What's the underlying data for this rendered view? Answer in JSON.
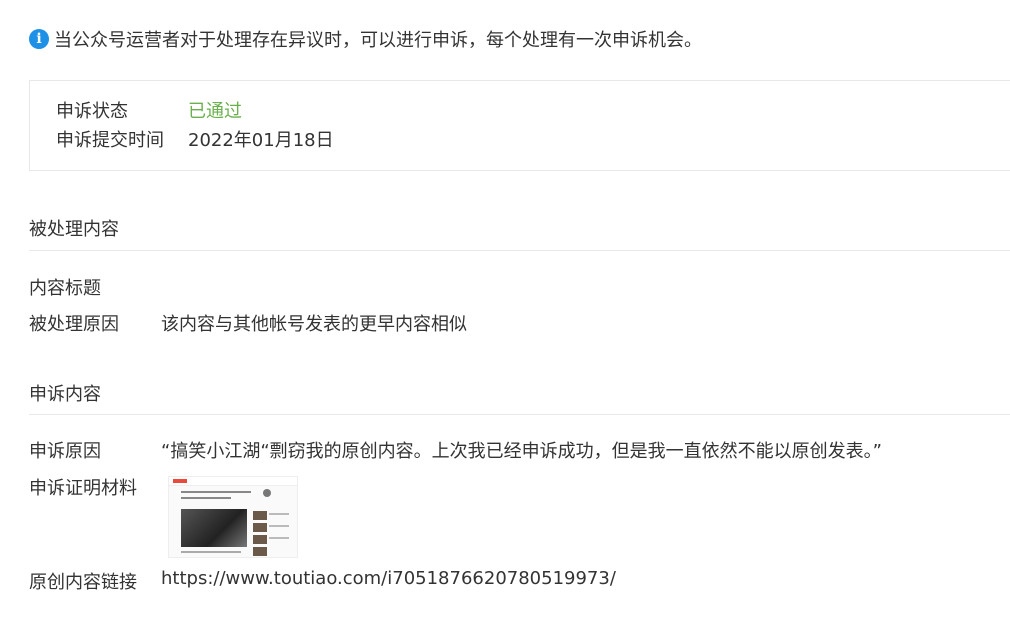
{
  "notice": {
    "icon": "info-icon",
    "text": "当公众号运营者对于处理存在异议时，可以进行申诉，每个处理有一次申诉机会。"
  },
  "appeal_status": {
    "status_label": "申诉状态",
    "status_value": "已通过",
    "status_color": "#6ab04c",
    "submit_time_label": "申诉提交时间",
    "submit_time_value": "2022年01月18日"
  },
  "handled_content": {
    "section_title": "被处理内容",
    "title_label": "内容标题",
    "title_value": "",
    "reason_label": "被处理原因",
    "reason_value": "该内容与其他帐号发表的更早内容相似"
  },
  "appeal_content": {
    "section_title": "申诉内容",
    "reason_label": "申诉原因",
    "reason_value": "“搞笑小江湖“剽窃我的原创内容。上次我已经申诉成功，但是我一直依然不能以原创发表。”",
    "evidence_label": "申诉证明材料",
    "link_label": "原创内容链接",
    "link_value": "https://www.toutiao.com/i7051876620780519973/"
  }
}
